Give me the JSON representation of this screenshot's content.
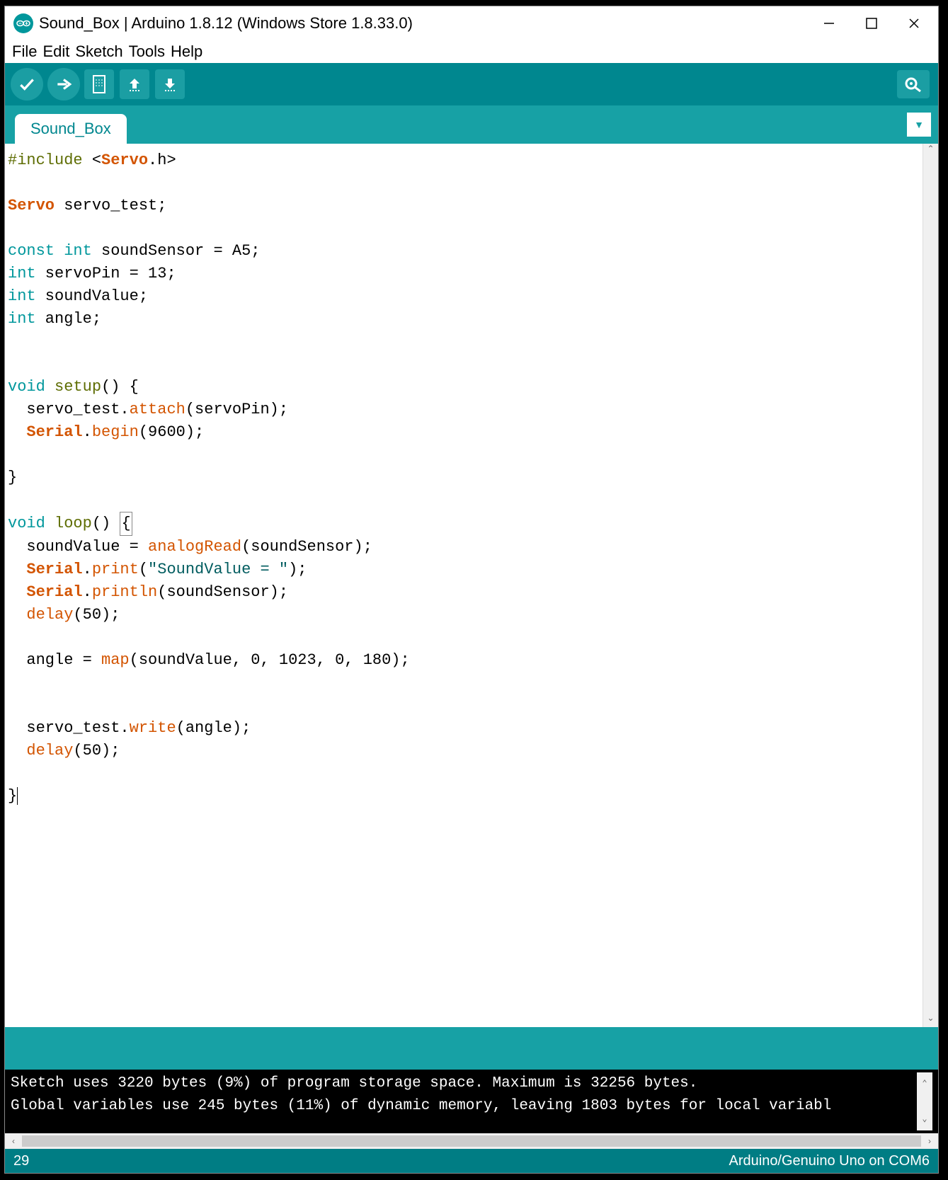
{
  "titlebar": {
    "title": "Sound_Box | Arduino 1.8.12 (Windows Store 1.8.33.0)"
  },
  "menubar": {
    "file": "File",
    "edit": "Edit",
    "sketch": "Sketch",
    "tools": "Tools",
    "help": "Help"
  },
  "tab": {
    "name": "Sound_Box"
  },
  "code": {
    "tokens": [
      [
        {
          "t": "#include ",
          "c": "c-preproc"
        },
        {
          "t": "<",
          "c": ""
        },
        {
          "t": "Servo",
          "c": "c-keyword c-bold"
        },
        {
          "t": ".h>",
          "c": ""
        }
      ],
      [],
      [
        {
          "t": "Servo",
          "c": "c-keyword c-bold"
        },
        {
          "t": " servo_test;",
          "c": ""
        }
      ],
      [],
      [
        {
          "t": "const int",
          "c": "c-type"
        },
        {
          "t": " soundSensor = A5;",
          "c": ""
        }
      ],
      [
        {
          "t": "int",
          "c": "c-type"
        },
        {
          "t": " servoPin = 13;",
          "c": ""
        }
      ],
      [
        {
          "t": "int",
          "c": "c-type"
        },
        {
          "t": " soundValue;",
          "c": ""
        }
      ],
      [
        {
          "t": "int",
          "c": "c-type"
        },
        {
          "t": " angle;",
          "c": ""
        }
      ],
      [],
      [],
      [
        {
          "t": "void",
          "c": "c-type"
        },
        {
          "t": " ",
          "c": ""
        },
        {
          "t": "setup",
          "c": "c-preproc"
        },
        {
          "t": "() {",
          "c": ""
        }
      ],
      [
        {
          "t": "  servo_test.",
          "c": ""
        },
        {
          "t": "attach",
          "c": "c-func"
        },
        {
          "t": "(servoPin);",
          "c": ""
        }
      ],
      [
        {
          "t": "  ",
          "c": ""
        },
        {
          "t": "Serial",
          "c": "c-keyword c-bold"
        },
        {
          "t": ".",
          "c": ""
        },
        {
          "t": "begin",
          "c": "c-func"
        },
        {
          "t": "(9600);",
          "c": ""
        }
      ],
      [],
      [
        {
          "t": "}",
          "c": ""
        }
      ],
      [],
      [
        {
          "t": "void",
          "c": "c-type"
        },
        {
          "t": " ",
          "c": ""
        },
        {
          "t": "loop",
          "c": "c-preproc"
        },
        {
          "t": "() ",
          "c": ""
        },
        {
          "t": "{",
          "c": "",
          "box": true
        }
      ],
      [
        {
          "t": "  soundValue = ",
          "c": ""
        },
        {
          "t": "analogRead",
          "c": "c-func"
        },
        {
          "t": "(soundSensor);",
          "c": ""
        }
      ],
      [
        {
          "t": "  ",
          "c": ""
        },
        {
          "t": "Serial",
          "c": "c-keyword c-bold"
        },
        {
          "t": ".",
          "c": ""
        },
        {
          "t": "print",
          "c": "c-func"
        },
        {
          "t": "(",
          "c": ""
        },
        {
          "t": "\"SoundValue = \"",
          "c": "c-string"
        },
        {
          "t": ");",
          "c": ""
        }
      ],
      [
        {
          "t": "  ",
          "c": ""
        },
        {
          "t": "Serial",
          "c": "c-keyword c-bold"
        },
        {
          "t": ".",
          "c": ""
        },
        {
          "t": "println",
          "c": "c-func"
        },
        {
          "t": "(soundSensor);",
          "c": ""
        }
      ],
      [
        {
          "t": "  ",
          "c": ""
        },
        {
          "t": "delay",
          "c": "c-func"
        },
        {
          "t": "(50);",
          "c": ""
        }
      ],
      [],
      [
        {
          "t": "  angle = ",
          "c": ""
        },
        {
          "t": "map",
          "c": "c-func"
        },
        {
          "t": "(soundValue, 0, 1023, 0, 180);",
          "c": ""
        }
      ],
      [],
      [],
      [
        {
          "t": "  servo_test.",
          "c": ""
        },
        {
          "t": "write",
          "c": "c-func"
        },
        {
          "t": "(angle);",
          "c": ""
        }
      ],
      [
        {
          "t": "  ",
          "c": ""
        },
        {
          "t": "delay",
          "c": "c-func"
        },
        {
          "t": "(50);",
          "c": ""
        }
      ],
      [],
      [
        {
          "t": "}",
          "c": ""
        },
        {
          "t": "|",
          "c": "",
          "cursor": true
        }
      ]
    ]
  },
  "console": {
    "line1": "Sketch uses 3220 bytes (9%) of program storage space. Maximum is 32256 bytes.",
    "line2": "Global variables use 245 bytes (11%) of dynamic memory, leaving 1803 bytes for local variabl"
  },
  "footer": {
    "line": "29",
    "board": "Arduino/Genuino Uno on COM6"
  }
}
